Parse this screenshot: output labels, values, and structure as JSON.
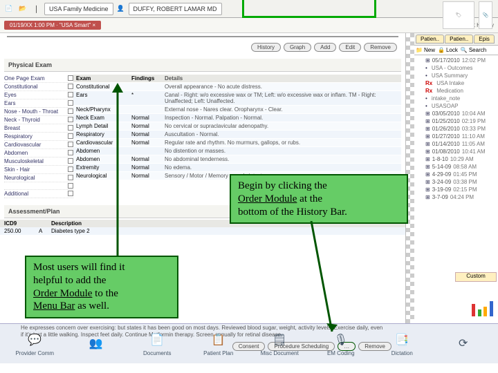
{
  "toolbar": {
    "tab1": "USA Family Medicine",
    "tab2": "DUFFY, ROBERT LAMAR MD"
  },
  "redTab": "01/19/XX 1:00 PM · \"USA Smart\"  ×",
  "buttons": {
    "history": "History",
    "graph": "Graph",
    "add": "Add",
    "edit": "Edit",
    "remove": "Remove",
    "consent": "Consent",
    "procsched": "Procedure Scheduling",
    "remove2": "Remove"
  },
  "sections": {
    "physexam": "Physical Exam",
    "assessplan": "Assessment/Plan"
  },
  "leftExamItems": [
    "One Page Exam",
    "Constitutional",
    "Eyes",
    "Ears",
    "Nose - Mouth - Throat",
    "Neck - Thyroid",
    "Breast",
    "Respiratory",
    "Cardiovascular",
    "Abdomen",
    "Musculoskeletal",
    "Skin - Hair",
    "Neurological",
    "",
    "Additional"
  ],
  "examHeaders": {
    "c1": "Exam",
    "c2": "Findings",
    "c3": "Details"
  },
  "examRows": [
    {
      "c1": "Constitutional",
      "c2": "",
      "c3": "Overall appearance - No acute distress."
    },
    {
      "c1": "Ears",
      "c2": "*",
      "c3": "Canal - Right: w/o excessive wax or TM; Left: w/o excessive wax or inflam. TM - Right: Unaffected; Left: Unaffected."
    },
    {
      "c1": "Neck/Pharynx",
      "c2": "",
      "c3": "External nose - Nares clear. Oropharynx - Clear."
    },
    {
      "c1": "Neck Exam",
      "c2": "Normal",
      "c3": "Inspection - Normal. Palpation - Normal."
    },
    {
      "c1": "Lymph Detail",
      "c2": "Normal",
      "c3": "No cervical or supraclavicular adenopathy."
    },
    {
      "c1": "Respiratory",
      "c2": "Normal",
      "c3": "Auscultation - Normal."
    },
    {
      "c1": "Cardiovascular",
      "c2": "Normal",
      "c3": "Regular rate and rhythm. No murmurs, gallops, or rubs."
    },
    {
      "c1": "Abdomen",
      "c2": "",
      "c3": "No distention or masses."
    },
    {
      "c1": "Abdomen",
      "c2": "Normal",
      "c3": "No abdominal tenderness."
    },
    {
      "c1": "Extremity",
      "c2": "Normal",
      "c3": "No edema."
    },
    {
      "c1": "Neurological",
      "c2": "Normal",
      "c3": "Sensory / Motor / Memory grossly intact."
    }
  ],
  "ap": {
    "h1": "ICD9",
    "h2": "",
    "h3": "Description",
    "r1a": "250.00",
    "r1b": "A",
    "r1c": "Diabetes type 2"
  },
  "noteText": "He expresses concern over exercising: but states it has been good on most days. Reviewed blood sugar, weight, activity levels. Exercise daily, even if it's just a little walking. Inspect feet daily. Continue Metformin therapy. Screen annually for retinal disease.",
  "historyBar": [
    {
      "label": "Provider Comm",
      "icon": "💬",
      "col": "#7c7"
    },
    {
      "label": "",
      "icon": "👥",
      "col": "#8ac"
    },
    {
      "label": "Documents",
      "icon": "📄",
      "col": "#db8"
    },
    {
      "label": "Patient Plan",
      "icon": "📋",
      "col": "#c9c"
    },
    {
      "label": "Misc Document",
      "icon": "🗒",
      "col": "#ccc"
    },
    {
      "label": "EM Coding",
      "icon": "🎙",
      "col": "#aac"
    },
    {
      "label": "Dictation",
      "icon": "📑",
      "col": "#ccc"
    },
    {
      "label": "",
      "icon": "⟳",
      "col": "#8cf"
    }
  ],
  "right": {
    "tabs": [
      "Patien..",
      "Patien..",
      "Epis"
    ],
    "folders": [
      "New",
      "Lock",
      "Search"
    ],
    "tree": [
      {
        "d": "05/17/2010",
        "t": "12:02 PM"
      },
      {
        "d": "",
        "t": "USA - Outcomes"
      },
      {
        "d": "",
        "t": "USA Summary"
      },
      {
        "d": "",
        "t": "USA Intake",
        "rx": true
      },
      {
        "d": "",
        "t": "Medication",
        "rx": true
      },
      {
        "d": "",
        "t": "intake_note"
      },
      {
        "d": "",
        "t": "USASOAP"
      },
      {
        "d": "03/05/2010",
        "t": "10:04 AM"
      },
      {
        "d": "01/25/2010",
        "t": "02:19 PM"
      },
      {
        "d": "01/26/2010",
        "t": "03:33 PM"
      },
      {
        "d": "01/27/2010",
        "t": "11:10 AM"
      },
      {
        "d": "01/14/2010",
        "t": "11:05 AM"
      },
      {
        "d": "01/08/2010",
        "t": "10:41 AM"
      },
      {
        "d": "1-8-10",
        "t": "10:29 AM"
      },
      {
        "d": "5-14-09",
        "t": "08:58 AM"
      },
      {
        "d": "4-29-09",
        "t": "01:45 PM"
      },
      {
        "d": "3-24-09",
        "t": "03:38 PM"
      },
      {
        "d": "3-19-09",
        "t": "02:15 PM"
      },
      {
        "d": "3-7-09",
        "t": "04:24 PM"
      }
    ],
    "custom": "Custom"
  },
  "callouts": {
    "c1": {
      "l1": "Begin by clicking the",
      "l2": "Order Module",
      "l3": " at the",
      "l4": "bottom of the History Bar."
    },
    "c2": {
      "l1": "Most users will find it",
      "l2": "helpful to add the",
      "l3": "Order Module",
      "l4": " to the",
      "l5": "Menu Bar",
      "l6": " as well."
    }
  }
}
